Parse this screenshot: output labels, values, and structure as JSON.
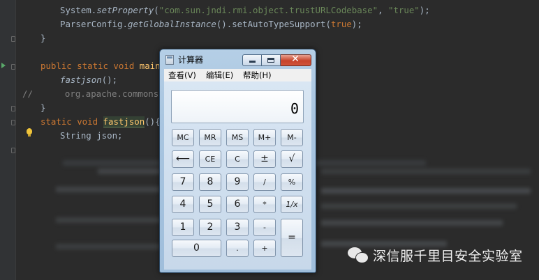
{
  "editor": {
    "lines": {
      "l1_code": "System.",
      "l1_method": "setProperty",
      "l1_arg1": "\"com.sun.jndi.rmi.object.trustURLCodebase\"",
      "l1_sep": ", ",
      "l1_arg2": "\"true\"",
      "l1_end": ");",
      "l2_code": "ParserConfig.",
      "l2_method": "getGlobalInstance",
      "l2_mid": "().setAutoTypeSupport(",
      "l2_kw": "true",
      "l2_end": ");",
      "l3": "}",
      "l4_kw": "public static void ",
      "l4_fn": "main(",
      "l5_fn": "fastjson",
      "l5_end": "();",
      "l6_cmt": "//",
      "l6_code": "org.apache.commons",
      "l7": "}",
      "l8_kw": "static void ",
      "l8_fn": "fastjson",
      "l8_end": "(){",
      "l9_type": "String json;"
    }
  },
  "calculator": {
    "title": "计算器",
    "close_glyph": "✕",
    "menu": [
      "查看(V)",
      "编辑(E)",
      "帮助(H)"
    ],
    "display_value": "0",
    "keys": {
      "mc": "MC",
      "mr": "MR",
      "ms": "MS",
      "mplus": "M+",
      "mminus": "M-",
      "back": "⟵",
      "ce": "CE",
      "c": "C",
      "pm": "±",
      "sqrt": "√",
      "k7": "7",
      "k8": "8",
      "k9": "9",
      "div": "/",
      "pct": "%",
      "k4": "4",
      "k5": "5",
      "k6": "6",
      "mul": "*",
      "recip": "1/x",
      "k1": "1",
      "k2": "2",
      "k3": "3",
      "sub": "-",
      "eq": "=",
      "k0": "0",
      "dot": ".",
      "add": "+"
    }
  },
  "watermark": {
    "text": "深信服千里目安全实验室"
  },
  "colors": {
    "editor_bg": "#2b2b2b",
    "keyword": "#cc7832",
    "string": "#6a8759",
    "calc_frame": "#a9c5e0"
  }
}
